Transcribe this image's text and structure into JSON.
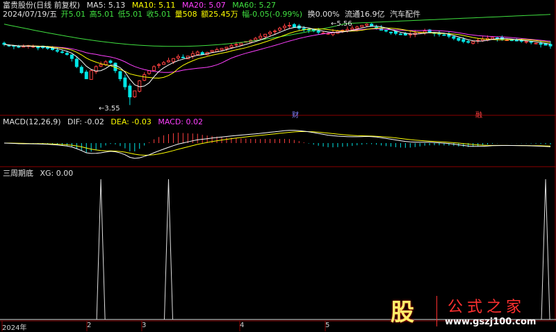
{
  "header": {
    "stock": "富贵股份(日线 前复权)",
    "ma5": "MA5: 5.13",
    "ma10": "MA10: 5.11",
    "ma20": "MA20: 5.07",
    "ma60": "MA60: 5.27",
    "date": "2024/07/19/五",
    "open": "开5.01",
    "high": "高5.01",
    "low": "低5.01",
    "close": "收5.01",
    "vol": "量508",
    "amount": "额25.45万",
    "change": "幅-0.05(-0.99%)",
    "turnover": "换0.00%",
    "float": "流通16.9亿",
    "sector": "汽车配件"
  },
  "macd_header": {
    "name": "MACD(12,26,9)",
    "dif": "DIF: -0.02",
    "dea": "DEA: -0.03",
    "macd": "MACD: 0.02"
  },
  "xg_header": {
    "name": "三周期底",
    "xg": "XG: 0.00"
  },
  "markers": {
    "low_label": "3.55",
    "high_label": "5.56",
    "fin1": "财",
    "fin2": "融"
  },
  "logo": {
    "glyph": "股",
    "name": "公式之家",
    "url": "www.gszj100.com"
  },
  "colors": {
    "ma5": "#ffffff",
    "ma10": "#ffff00",
    "ma20": "#ff40ff",
    "ma60": "#40e040",
    "up": "#ff4040",
    "down": "#00e6e6",
    "grid": "#8b0000"
  },
  "chart_data": [
    {
      "type": "candlestick",
      "title": "",
      "x_axis_labels": [
        "2024年",
        "2",
        "3",
        "4",
        "5"
      ],
      "ylim": [
        3.4,
        5.7
      ],
      "series": [
        {
          "name": "close",
          "values": [
            5.05,
            5.02,
            5.0,
            4.98,
            5.0,
            5.02,
            5.0,
            4.98,
            4.97,
            4.95,
            4.92,
            4.88,
            4.85,
            4.8,
            4.7,
            4.5,
            4.35,
            4.2,
            4.4,
            4.5,
            4.55,
            4.62,
            4.6,
            4.4,
            4.2,
            4.0,
            3.75,
            3.9,
            4.15,
            4.3,
            4.4,
            4.5,
            4.55,
            4.6,
            4.65,
            4.7,
            4.75,
            4.72,
            4.76,
            4.82,
            4.86,
            4.8,
            4.85,
            4.9,
            4.92,
            4.95,
            4.98,
            5.02,
            5.05,
            5.08,
            5.12,
            5.15,
            5.2,
            5.25,
            5.3,
            5.35,
            5.38,
            5.45,
            5.5,
            5.52,
            5.48,
            5.45,
            5.42,
            5.4,
            5.38,
            5.35,
            5.33,
            5.32,
            5.35,
            5.38,
            5.4,
            5.42,
            5.45,
            5.48,
            5.52,
            5.55,
            5.5,
            5.45,
            5.4,
            5.38,
            5.35,
            5.32,
            5.3,
            5.28,
            5.3,
            5.33,
            5.35,
            5.38,
            5.35,
            5.32,
            5.3,
            5.28,
            5.25,
            5.2,
            5.15,
            5.12,
            5.1,
            5.12,
            5.15,
            5.18,
            5.2,
            5.22,
            5.2,
            5.18,
            5.16,
            5.15,
            5.14,
            5.13,
            5.12,
            5.1,
            5.08,
            5.05,
            5.03,
            5.01
          ]
        },
        {
          "name": "MA5",
          "values": []
        },
        {
          "name": "MA10",
          "values": []
        },
        {
          "name": "MA20",
          "values": []
        },
        {
          "name": "MA60",
          "values": []
        }
      ]
    },
    {
      "type": "bar",
      "title": "MACD(12,26,9)",
      "series": [
        {
          "name": "DIF",
          "values": []
        },
        {
          "name": "DEA",
          "values": []
        },
        {
          "name": "MACD",
          "values": []
        }
      ]
    },
    {
      "type": "line",
      "title": "三周期底",
      "series": [
        {
          "name": "XG",
          "spikes_at_index": [
            20,
            34,
            112
          ],
          "values": [
            0,
            1
          ]
        }
      ]
    }
  ]
}
